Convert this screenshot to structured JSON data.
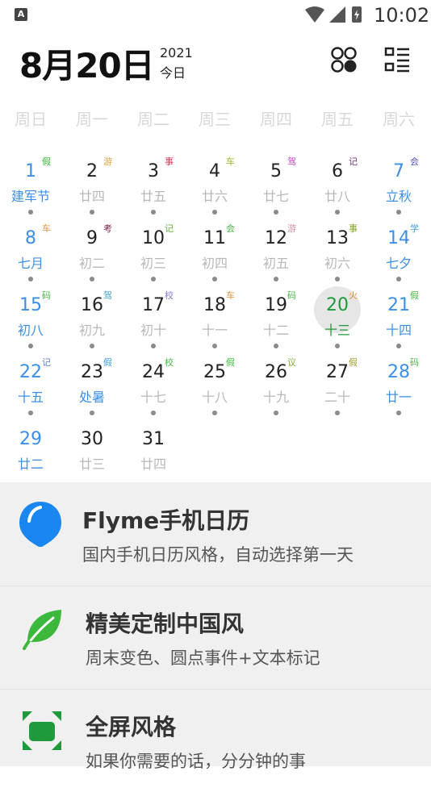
{
  "status": {
    "time": "10:02",
    "app_badge": "A"
  },
  "header": {
    "date": "8月20日",
    "year": "2021",
    "today_label": "今日"
  },
  "weekdays": [
    "周日",
    "周一",
    "周二",
    "周三",
    "周四",
    "周五",
    "周六"
  ],
  "days": [
    {
      "num": "1",
      "sub": "建军节",
      "tag": "假",
      "tag_color": "#33bb33",
      "weekend": true,
      "festival": true
    },
    {
      "num": "2",
      "sub": "廿四",
      "tag": "游",
      "tag_color": "#e0a040"
    },
    {
      "num": "3",
      "sub": "廿五",
      "tag": "事",
      "tag_color": "#e0365a"
    },
    {
      "num": "4",
      "sub": "廿六",
      "tag": "车",
      "tag_color": "#a0b020"
    },
    {
      "num": "5",
      "sub": "廿七",
      "tag": "驾",
      "tag_color": "#c040c0"
    },
    {
      "num": "6",
      "sub": "廿八",
      "tag": "记",
      "tag_color": "#7a3080"
    },
    {
      "num": "7",
      "sub": "立秋",
      "tag": "会",
      "tag_color": "#5050c0",
      "weekend": true,
      "festival": true
    },
    {
      "num": "8",
      "sub": "七月",
      "tag": "车",
      "tag_color": "#e09040",
      "weekend": true
    },
    {
      "num": "9",
      "sub": "初二",
      "tag": "考",
      "tag_color": "#802040"
    },
    {
      "num": "10",
      "sub": "初三",
      "tag": "记",
      "tag_color": "#60b040"
    },
    {
      "num": "11",
      "sub": "初四",
      "tag": "会",
      "tag_color": "#40b040"
    },
    {
      "num": "12",
      "sub": "初五",
      "tag": "游",
      "tag_color": "#d090a0"
    },
    {
      "num": "13",
      "sub": "初六",
      "tag": "事",
      "tag_color": "#80a020"
    },
    {
      "num": "14",
      "sub": "七夕",
      "tag": "学",
      "tag_color": "#40a0e0",
      "weekend": true,
      "festival": true
    },
    {
      "num": "15",
      "sub": "初八",
      "tag": "码",
      "tag_color": "#40c040",
      "weekend": true
    },
    {
      "num": "16",
      "sub": "初九",
      "tag": "驾",
      "tag_color": "#40a0d0"
    },
    {
      "num": "17",
      "sub": "初十",
      "tag": "校",
      "tag_color": "#8080d0"
    },
    {
      "num": "18",
      "sub": "十一",
      "tag": "车",
      "tag_color": "#e09040"
    },
    {
      "num": "19",
      "sub": "十二",
      "tag": "码",
      "tag_color": "#40c040"
    },
    {
      "num": "20",
      "sub": "十三",
      "tag": "火",
      "tag_color": "#e09030",
      "today": true
    },
    {
      "num": "21",
      "sub": "十四",
      "tag": "假",
      "tag_color": "#40c040",
      "weekend": true
    },
    {
      "num": "22",
      "sub": "十五",
      "tag": "记",
      "tag_color": "#6080d0",
      "weekend": true
    },
    {
      "num": "23",
      "sub": "处暑",
      "tag": "假",
      "tag_color": "#40a0e0",
      "festival": true
    },
    {
      "num": "24",
      "sub": "十七",
      "tag": "校",
      "tag_color": "#40c040"
    },
    {
      "num": "25",
      "sub": "十八",
      "tag": "假",
      "tag_color": "#40c040"
    },
    {
      "num": "26",
      "sub": "十九",
      "tag": "议",
      "tag_color": "#80b040"
    },
    {
      "num": "27",
      "sub": "二十",
      "tag": "假",
      "tag_color": "#a0a030"
    },
    {
      "num": "28",
      "sub": "廿一",
      "tag": "码",
      "tag_color": "#40c040",
      "weekend": true
    },
    {
      "num": "29",
      "sub": "廿二",
      "tag": "",
      "tag_color": "",
      "weekend": true
    },
    {
      "num": "30",
      "sub": "廿三",
      "tag": "",
      "tag_color": ""
    },
    {
      "num": "31",
      "sub": "廿四",
      "tag": "",
      "tag_color": ""
    }
  ],
  "promo": [
    {
      "title": "Flyme手机日历",
      "desc": "国内手机日历风格，自动选择第一天",
      "icon": "balloon-icon",
      "color": "#1a86f0"
    },
    {
      "title": "精美定制中国风",
      "desc": "周末变色、圆点事件+文本标记",
      "icon": "leaf-icon",
      "color": "#3cb83c"
    },
    {
      "title": "全屏风格",
      "desc": "如果你需要的话，分分钟的事",
      "icon": "fullscreen-icon",
      "color": "#1e9a3c"
    }
  ],
  "colors": {
    "weekend": "#3d8fe6",
    "today": "#1e9a3c",
    "lunar": "#b8b8b8"
  }
}
